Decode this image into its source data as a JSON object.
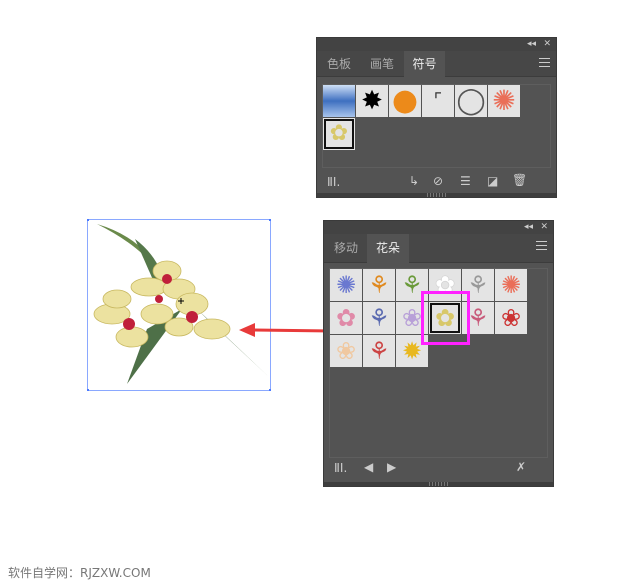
{
  "symbols_panel": {
    "tabs": [
      {
        "label": "色板"
      },
      {
        "label": "画笔"
      },
      {
        "label": "符号",
        "active": true
      }
    ],
    "symbols": [
      {
        "name": "blue-banner",
        "bg": "#3e6fc0",
        "glyph": ""
      },
      {
        "name": "ink-splat",
        "bg": "#e4e4e4",
        "glyph": "✸"
      },
      {
        "name": "orange-button",
        "bg": "#e4e4e4",
        "glyph": "●"
      },
      {
        "name": "corner-marks",
        "bg": "#e4e4e4",
        "glyph": "⌜"
      },
      {
        "name": "ring",
        "bg": "#e4e4e4",
        "glyph": "◯"
      },
      {
        "name": "gerbera",
        "bg": "#e4e4e4",
        "glyph": "✺"
      },
      {
        "name": "orchid",
        "bg": "#e4e4e4",
        "glyph": "✿",
        "selected": true
      }
    ]
  },
  "flowers_panel": {
    "tabs": [
      {
        "label": "移动"
      },
      {
        "label": "花朵",
        "active": true
      }
    ],
    "symbols": [
      {
        "name": "aster",
        "glyph": "✺",
        "color": "#6a78d0"
      },
      {
        "name": "bird-of-paradise",
        "glyph": "⚘",
        "color": "#e08a20"
      },
      {
        "name": "calla-lily",
        "glyph": "⚘",
        "color": "#6a9a3a"
      },
      {
        "name": "daisy",
        "glyph": "✿",
        "color": "#ffffff"
      },
      {
        "name": "allium",
        "glyph": "⚘",
        "color": "#999999"
      },
      {
        "name": "gerbera",
        "glyph": "✺",
        "color": "#ea6e58"
      },
      {
        "name": "hibiscus",
        "glyph": "✿",
        "color": "#e08aa8"
      },
      {
        "name": "iris",
        "glyph": "⚘",
        "color": "#5a6ab0"
      },
      {
        "name": "water-lily",
        "glyph": "❀",
        "color": "#b8a0d8"
      },
      {
        "name": "orchid",
        "glyph": "✿",
        "color": "#d8c86a",
        "selected": true
      },
      {
        "name": "echinacea",
        "glyph": "⚘",
        "color": "#c85a7a"
      },
      {
        "name": "rose",
        "glyph": "❀",
        "color": "#cc3333"
      },
      {
        "name": "peach-rose",
        "glyph": "❀",
        "color": "#f0c8a0"
      },
      {
        "name": "rosebud",
        "glyph": "⚘",
        "color": "#cc4444"
      },
      {
        "name": "sunflower",
        "glyph": "✹",
        "color": "#e8b820"
      }
    ]
  },
  "colors": {
    "highlight": "#ff22ff",
    "arrow": "#e83a3a"
  },
  "footer": "软件自学网：RJZXW.COM"
}
